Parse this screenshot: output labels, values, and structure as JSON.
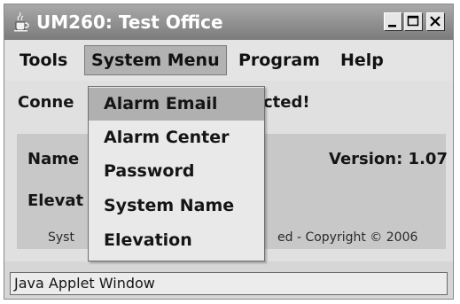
{
  "window": {
    "title": "UM260: Test Office",
    "icon": "java-cup-icon",
    "controls": [
      "minimize-icon",
      "maximize-icon",
      "close-icon"
    ]
  },
  "menubar": {
    "items": [
      {
        "label": "Tools"
      },
      {
        "label": "System Menu",
        "active": true
      },
      {
        "label": "Program"
      },
      {
        "label": "Help"
      }
    ]
  },
  "dropdown": {
    "items": [
      {
        "label": "Alarm Email",
        "highlighted": true
      },
      {
        "label": "Alarm Center"
      },
      {
        "label": "Password"
      },
      {
        "label": "System Name"
      },
      {
        "label": "Elevation"
      }
    ]
  },
  "content": {
    "status_left": "Conne",
    "status_right": "cted!",
    "name_label": "Name",
    "version": "Version: 1.07",
    "elevation_label": "Elevat",
    "copyright_left": "Syst",
    "copyright_right": "ed - Copyright © 2006"
  },
  "footer": {
    "text": "Java Applet Window"
  },
  "colors": {
    "titlebar": "#7b7b7b",
    "menubar": "#e4e4e4",
    "highlight": "#b0b0b0",
    "panel": "#c8c8c8"
  }
}
